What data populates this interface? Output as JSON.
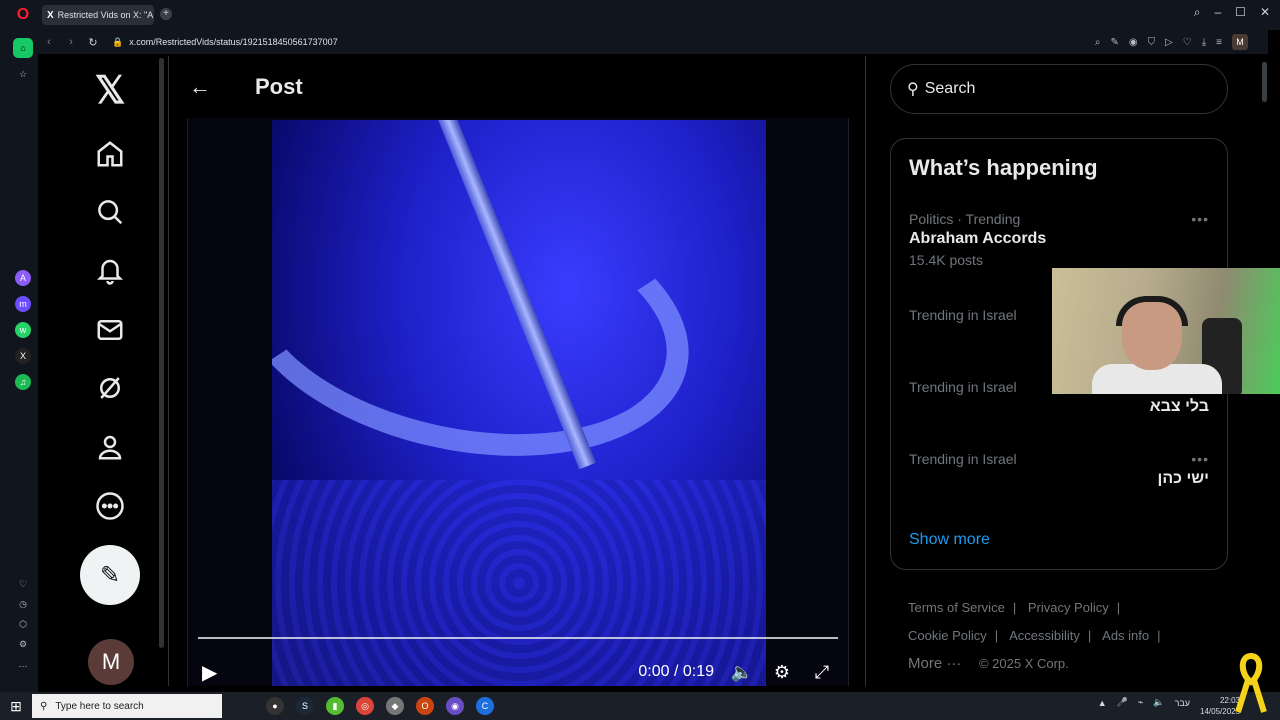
{
  "browser": {
    "tab_title": "Restricted Vids on X: \"A fa",
    "tab_x_icon": "X",
    "new_tab": "+",
    "url": "x.com/RestrictedVids/status/1921518450561737007",
    "profile_initial": "M"
  },
  "x": {
    "logo": "𝕏",
    "header_title": "Post",
    "avatar_initial": "M",
    "nav": [
      "home-icon",
      "explore-icon",
      "notifications-icon",
      "messages-icon",
      "grok-icon",
      "profile-icon",
      "more-icon"
    ]
  },
  "video": {
    "time": "0:00 / 0:19"
  },
  "search": {
    "placeholder": "Search"
  },
  "happening": {
    "title": "What’s happening",
    "trends": [
      {
        "meta": "Politics · Trending",
        "name": "Abraham Accords",
        "count": "15.4K posts"
      },
      {
        "meta": "Trending in Israel",
        "name": "",
        "count": ""
      },
      {
        "meta": "Trending in Israel",
        "name": "בלי צבא",
        "count": ""
      },
      {
        "meta": "Trending in Israel",
        "name": "ישי כהן",
        "count": ""
      }
    ],
    "show_more": "Show more"
  },
  "footer": {
    "terms": "Terms of Service",
    "privacy": "Privacy Policy",
    "cookie": "Cookie Policy",
    "accessibility": "Accessibility",
    "ads": "Ads info",
    "more": "More ···",
    "copyright": "© 2025 X Corp."
  },
  "taskbar": {
    "search_placeholder": "Type here to search",
    "lang": "עבר",
    "time": "22:03",
    "date": "14/05/2025"
  }
}
